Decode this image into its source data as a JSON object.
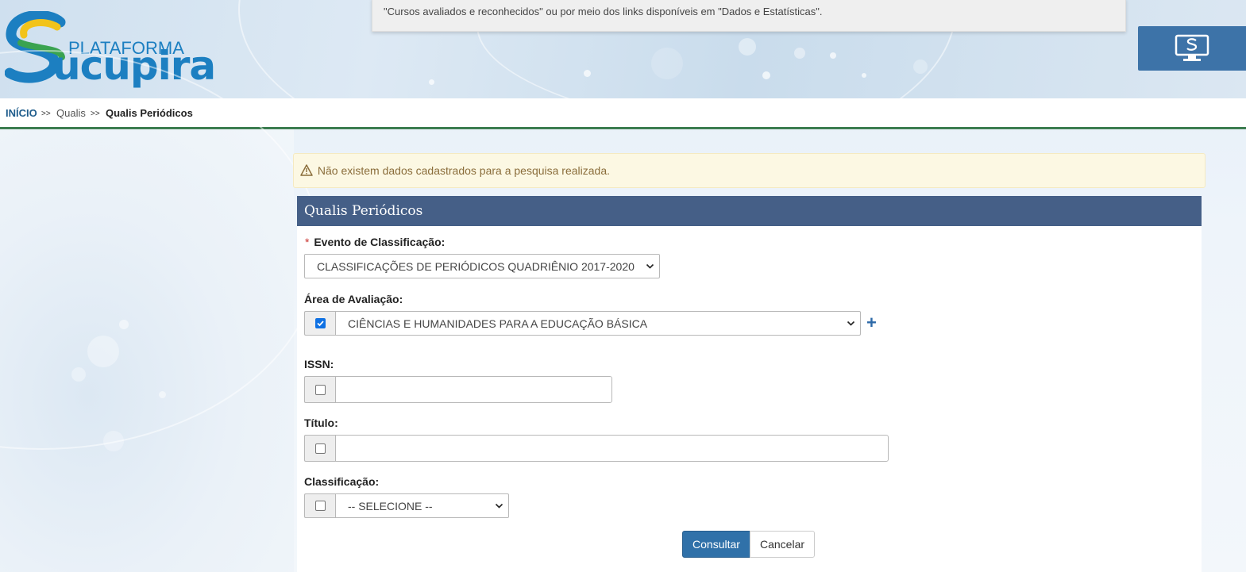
{
  "header": {
    "logo_small": "PLATAFORMA",
    "logo_big": "ucupira",
    "info_text": "\"Cursos avaliados e reconhecidos\" ou por meio dos links disponíveis em \"Dados e Estatísticas\".",
    "monitor_icon": "monitor-sucupira-icon"
  },
  "breadcrumb": {
    "home": "INÍCIO",
    "sep": ">>",
    "qualis": "Qualis",
    "current": "Qualis Periódicos"
  },
  "alert": {
    "icon": "warning-icon",
    "text": "Não existem dados cadastrados para a pesquisa realizada."
  },
  "panel": {
    "title": "Qualis Periódicos",
    "evento": {
      "required_mark": "*",
      "label": "Evento de Classificação:",
      "value": "CLASSIFICAÇÕES DE PERIÓDICOS QUADRIÊNIO 2017-2020"
    },
    "area": {
      "label": "Área de Avaliação:",
      "checked": true,
      "value": "CIÊNCIAS E HUMANIDADES PARA A EDUCAÇÃO BÁSICA",
      "add": "+"
    },
    "issn": {
      "label": "ISSN:",
      "checked": false,
      "value": ""
    },
    "titulo": {
      "label": "Título:",
      "checked": false,
      "value": ""
    },
    "classificacao": {
      "label": "Classificação:",
      "checked": false,
      "value": "-- SELECIONE --"
    },
    "buttons": {
      "consultar": "Consultar",
      "cancelar": "Cancelar"
    }
  },
  "colors": {
    "panel_heading": "#455f87",
    "primary": "#3071a9",
    "breadcrumb_border": "#3c7d50",
    "alert_bg": "#fcf8e3",
    "logo_blue": "#1c7fc1",
    "logo_yellow": "#f2c31b",
    "logo_green": "#3aa350"
  }
}
